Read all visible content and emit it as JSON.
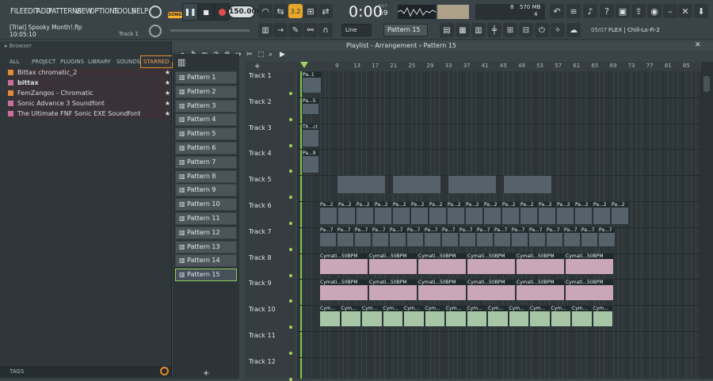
{
  "menu": [
    "FILE",
    "EDIT",
    "ADD",
    "PATTERNS",
    "VIEW",
    "OPTIONS",
    "TOOLS",
    "HELP"
  ],
  "transport": {
    "mode": "SONG",
    "tempo": "150.000",
    "time": "0:00",
    "time_sub": "59",
    "bst": "B:S:T"
  },
  "project": {
    "title": "[Trial] Spooky Month!.flp",
    "time": "10:05:10",
    "track": "Track 1"
  },
  "monitor": {
    "cpu": "8",
    "mem": "570 MB",
    "poly": "4"
  },
  "news": {
    "index": "05/07",
    "text": "FLEX | Chill-Lo-Fi-2"
  },
  "toolbar2": {
    "snap": "Line",
    "pattern": "Pattern 15"
  },
  "browser": {
    "title": "Browser",
    "tabs": [
      "ALL",
      "PROJECT",
      "PLUGINS",
      "LIBRARY",
      "SOUNDS",
      "STARRED"
    ],
    "active_tab": "STARRED",
    "items": [
      {
        "label": "Bittax chromatic_2",
        "bold": false
      },
      {
        "label": "bittax",
        "bold": true
      },
      {
        "label": "FemZangos - Chromatic",
        "bold": false
      },
      {
        "label": "Sonic Advance 3 Soundfont",
        "bold": false
      },
      {
        "label": "The Ultimate FNF Sonic EXE Soundfont",
        "bold": false
      }
    ],
    "tags_label": "TAGS"
  },
  "playlist": {
    "title": "Playlist - Arrangement",
    "pattern": "Pattern 15",
    "ruler": [
      "9",
      "13",
      "17",
      "21",
      "25",
      "29",
      "33",
      "37",
      "41",
      "45",
      "49",
      "53",
      "57",
      "61",
      "65",
      "69",
      "73",
      "77",
      "81",
      "85"
    ],
    "tracks": [
      "Track 1",
      "Track 2",
      "Track 3",
      "Track 4",
      "Track 5",
      "Track 6",
      "Track 7",
      "Track 8",
      "Track 9",
      "Track 10",
      "Track 11",
      "Track 12"
    ]
  },
  "patterns": [
    "Pattern 1",
    "Pattern 2",
    "Pattern 3",
    "Pattern 4",
    "Pattern 5",
    "Pattern 6",
    "Pattern 7",
    "Pattern 8",
    "Pattern 9",
    "Pattern 10",
    "Pattern 11",
    "Pattern 12",
    "Pattern 13",
    "Pattern 14",
    "Pattern 15"
  ],
  "clips": {
    "t1": "Pa..1",
    "t2": "Pa...5",
    "t3": "Th...ct",
    "t4": "Pa...9",
    "t6": "Pa...2",
    "t7": "Pa...7",
    "t8": "Cymati...50BPM",
    "t10": "Cym..."
  },
  "colors": {
    "accent": "#8ccf5a",
    "pink_clip": "#c9a7b8",
    "green_clip": "#a6c6a6",
    "starred_tab": "#e8892d"
  }
}
